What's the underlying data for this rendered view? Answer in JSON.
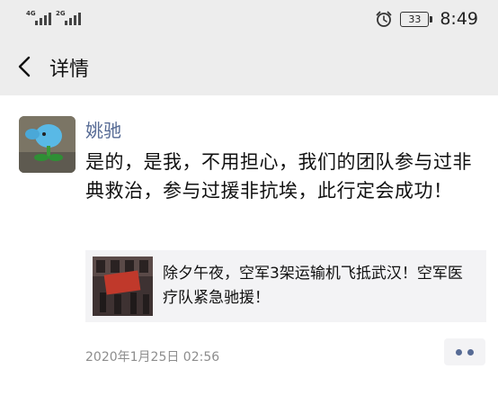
{
  "status_bar": {
    "signal_1_label": "4G",
    "signal_2_label": "2G",
    "battery": "33",
    "time": "8:49",
    "icons": [
      "signal-icon",
      "alarm-icon",
      "battery-icon"
    ]
  },
  "nav": {
    "back_icon": "chevron-left-icon",
    "title": "详情"
  },
  "post": {
    "username": "姚驰",
    "text": "是的，是我，不用担心，我们的团队参与过非典救治，参与过援非抗埃，此行定会成功！",
    "link_title": "除夕午夜，空军3架运输机飞抵武汉！空军医疗队紧急驰援！",
    "timestamp": "2020年1月25日 02:56",
    "more_icon": "more-dots-icon"
  },
  "colors": {
    "background": "#ededed",
    "content_bg": "#ffffff",
    "username": "#576b95",
    "link_card_bg": "#f3f3f5",
    "timestamp": "#8d8d8d"
  }
}
